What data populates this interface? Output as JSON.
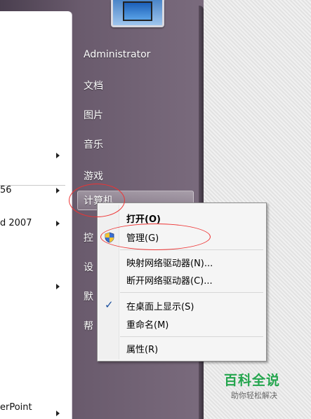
{
  "left_panel": {
    "items": [
      {
        "label": "56",
        "has_arrow": true
      },
      {
        "label": "d 2007",
        "has_arrow": true
      },
      {
        "label": "erPoint",
        "has_arrow": true
      }
    ]
  },
  "right_panel": {
    "items": [
      {
        "label": "Administrator"
      },
      {
        "label": "文档"
      },
      {
        "label": "图片"
      },
      {
        "label": "音乐"
      },
      {
        "label": "游戏"
      },
      {
        "label": "计算机"
      },
      {
        "label": "控"
      },
      {
        "label": "设"
      },
      {
        "label": "默"
      },
      {
        "label": "帮"
      }
    ]
  },
  "context_menu": {
    "items": [
      {
        "label": "打开(O)",
        "bold": true
      },
      {
        "label": "管理(G)",
        "icon": "uac-shield-icon"
      },
      {
        "label": "映射网络驱动器(N)..."
      },
      {
        "label": "断开网络驱动器(C)..."
      },
      {
        "label": "在桌面上显示(S)",
        "checked": true
      },
      {
        "label": "重命名(M)"
      },
      {
        "label": "属性(R)"
      }
    ]
  },
  "watermark": {
    "title": "百科全说",
    "subtitle": "助你轻松解决"
  },
  "colors": {
    "menu_dark": "#6a5b6d",
    "annotation_red": "#ee3333",
    "watermark_green": "#23a54d"
  }
}
